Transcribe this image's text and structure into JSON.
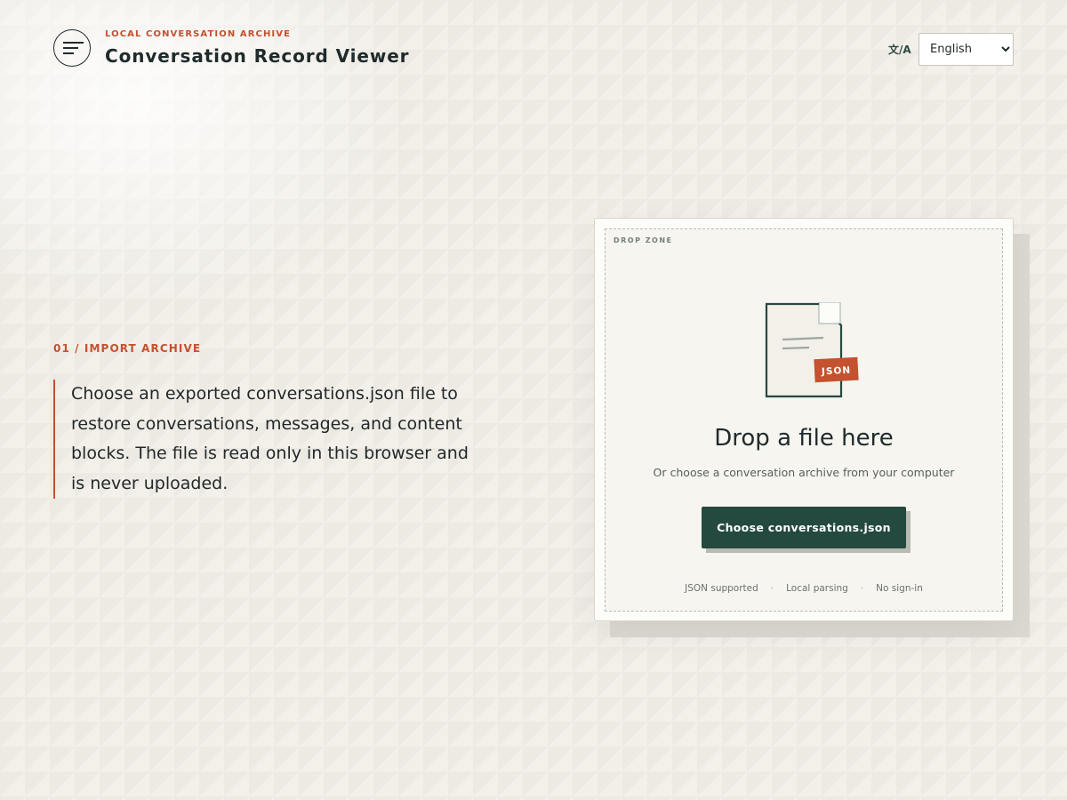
{
  "header": {
    "eyebrow": "LOCAL CONVERSATION ARCHIVE",
    "title": "Conversation Record Viewer",
    "brand_icon": "menu-lines-icon",
    "language": {
      "icon_text": "文/A",
      "icon": "translate-icon",
      "selected": "English",
      "options": [
        "English"
      ]
    }
  },
  "intro": {
    "step_label": "01 / IMPORT ARCHIVE",
    "description": "Choose an exported conversations.json file to restore conversations, messages, and content blocks. The file is read only in this browser and is never uploaded."
  },
  "dropzone": {
    "label": "DROP ZONE",
    "file_icon": "json-file-icon",
    "file_badge": "JSON",
    "title": "Drop a file here",
    "subtitle": "Or choose a conversation archive from your computer",
    "button_label": "Choose conversations.json",
    "features": [
      "JSON supported",
      "Local parsing",
      "No sign-in"
    ]
  },
  "colors": {
    "accent": "#c4512f",
    "primary": "#244a3f",
    "background": "#f3f0ea",
    "text": "#22282a"
  }
}
